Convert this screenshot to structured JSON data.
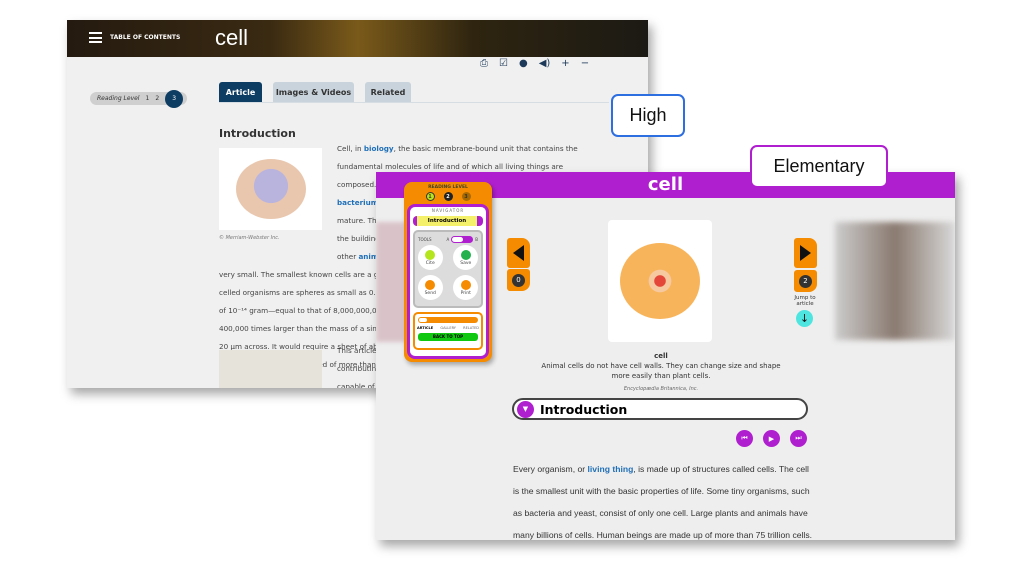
{
  "high": {
    "label": "High",
    "header": {
      "toc_label": "TABLE OF CONTENTS",
      "title": "cell"
    },
    "toolbar": [
      "print-icon",
      "checklist-icon",
      "globe-icon",
      "speaker-icon",
      "plus-icon",
      "minus-icon"
    ],
    "reading_level": {
      "label": "Reading Level",
      "levels": [
        "1",
        "2",
        "3"
      ],
      "selected": "3"
    },
    "tabs": [
      "Article",
      "Images & Videos",
      "Related"
    ],
    "heading": "Introduction",
    "image_credit": "© Merriam-Webster Inc.",
    "paragraph_lines": [
      {
        "pre": "Cell, in ",
        "link": "biology",
        "post": ", the basic membrane-bound unit that contains the"
      },
      {
        "pre": "fundamental molecules of life and of which all living things are"
      },
      {
        "pre": "composed."
      },
      {
        "link": "bacterium"
      },
      {
        "pre": "mature. Th"
      },
      {
        "pre": "the building"
      },
      {
        "pre": "other ",
        "link": "anim"
      },
      {
        "pre": "very small. The smallest known cells are a gro"
      },
      {
        "pre": "celled organisms are spheres as small as 0.2 μ"
      },
      {
        "pre": "of 10⁻¹⁴ gram—equal to that of 8,000,000,000"
      },
      {
        "pre": "400,000 times larger than the mass of a single"
      },
      {
        "pre": "20 μm across. It would require a sheet of abo"
      },
      {
        "pre": "human organism is composed of more than 3"
      }
    ],
    "paragraph2_lines": [
      "This article",
      "contributin",
      "capable of r"
    ]
  },
  "elementary": {
    "label": "Elementary",
    "title": "cell",
    "navigator": {
      "reading_level_label": "READING LEVEL",
      "levels": [
        "1",
        "2",
        "3"
      ],
      "selected": "1",
      "navigator_label": "NAVIGATOR",
      "section": "Introduction",
      "tools_label": "TOOLS",
      "toggle_a": "A",
      "toggle_b": "B",
      "tools": [
        {
          "label": "Cite",
          "color": "#b5e61d"
        },
        {
          "label": "Save",
          "color": "#22b14c"
        },
        {
          "label": "Send",
          "color": "#f58b00"
        },
        {
          "label": "Print",
          "color": "#f58b00"
        }
      ],
      "tabs": [
        "ARTICLE",
        "GALLERY",
        "RELATED"
      ],
      "back_to_top": "BACK TO TOP"
    },
    "prev_count": "0",
    "next_count": "2",
    "jump_label": "Jump to article",
    "caption": {
      "title": "cell",
      "text": "Animal cells do not have cell walls. They can change size and shape more easily than plant cells.",
      "credit": "Encyclopædia Britannica, Inc."
    },
    "section_heading": "Introduction",
    "paragraph": {
      "pre": "Every organism, or ",
      "link": "living thing",
      "post": ", is made up of structures called cells. The cell is the smallest unit with the basic properties of life. Some tiny organisms, such as bacteria and yeast, consist of only one cell. Large plants and animals have many billions of cells. Human beings are made up of more than 75 trillion cells. The study of cells is a branch of"
    }
  },
  "colors": {
    "purple": "#b01fcf",
    "orange": "#f58b00",
    "navy": "#0e3d63",
    "link": "#1f6fb8",
    "high_border": "#2d6ee0"
  }
}
